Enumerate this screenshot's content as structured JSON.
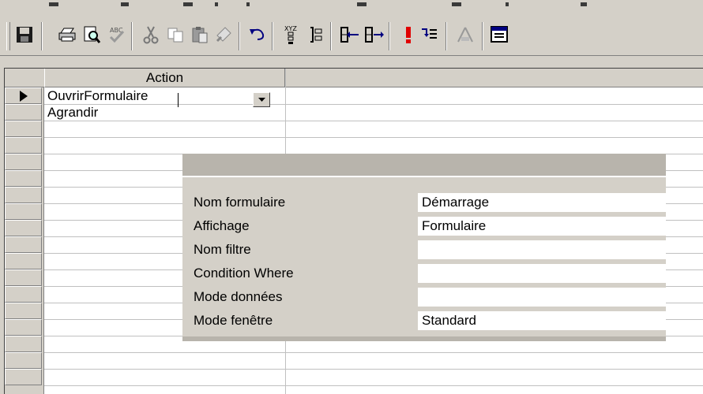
{
  "toolbar": {
    "buttons": [
      {
        "icon": "save-icon"
      },
      {
        "icon": "print-icon"
      },
      {
        "icon": "print-preview-icon"
      },
      {
        "icon": "spelling-icon"
      },
      {
        "icon": "cut-icon"
      },
      {
        "icon": "copy-icon"
      },
      {
        "icon": "paste-icon"
      },
      {
        "icon": "format-painter-icon"
      },
      {
        "icon": "undo-icon"
      },
      {
        "icon": "macro-names-icon"
      },
      {
        "icon": "conditions-icon"
      },
      {
        "icon": "insert-row-icon"
      },
      {
        "icon": "delete-row-icon"
      },
      {
        "icon": "run-icon"
      },
      {
        "icon": "single-step-icon"
      },
      {
        "icon": "build-icon"
      },
      {
        "icon": "database-window-icon"
      }
    ]
  },
  "grid": {
    "column_header": "Action",
    "rows": [
      {
        "action": "OuvrirFormulaire",
        "selected": true
      },
      {
        "action": "Agrandir",
        "selected": false
      }
    ]
  },
  "arguments": {
    "items": [
      {
        "label": "Nom formulaire",
        "value": "Démarrage"
      },
      {
        "label": "Affichage",
        "value": "Formulaire"
      },
      {
        "label": "Nom filtre",
        "value": ""
      },
      {
        "label": "Condition Where",
        "value": ""
      },
      {
        "label": "Mode données",
        "value": ""
      },
      {
        "label": "Mode fenêtre",
        "value": "Standard"
      }
    ]
  },
  "colors": {
    "face": "#d4d0c8",
    "shadow": "#808080",
    "highlight": "#ffffff"
  }
}
